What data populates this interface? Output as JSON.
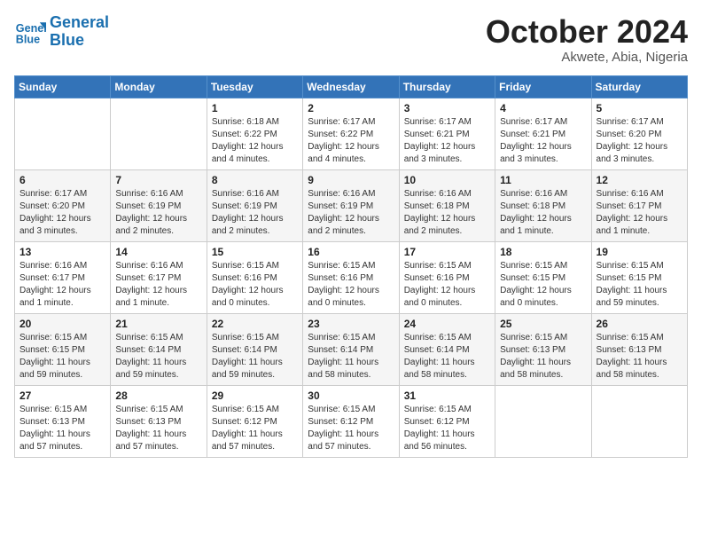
{
  "logo": {
    "line1": "General",
    "line2": "Blue"
  },
  "title": "October 2024",
  "location": "Akwete, Abia, Nigeria",
  "weekdays": [
    "Sunday",
    "Monday",
    "Tuesday",
    "Wednesday",
    "Thursday",
    "Friday",
    "Saturday"
  ],
  "weeks": [
    [
      {
        "day": "",
        "detail": ""
      },
      {
        "day": "",
        "detail": ""
      },
      {
        "day": "1",
        "detail": "Sunrise: 6:18 AM\nSunset: 6:22 PM\nDaylight: 12 hours\nand 4 minutes."
      },
      {
        "day": "2",
        "detail": "Sunrise: 6:17 AM\nSunset: 6:22 PM\nDaylight: 12 hours\nand 4 minutes."
      },
      {
        "day": "3",
        "detail": "Sunrise: 6:17 AM\nSunset: 6:21 PM\nDaylight: 12 hours\nand 3 minutes."
      },
      {
        "day": "4",
        "detail": "Sunrise: 6:17 AM\nSunset: 6:21 PM\nDaylight: 12 hours\nand 3 minutes."
      },
      {
        "day": "5",
        "detail": "Sunrise: 6:17 AM\nSunset: 6:20 PM\nDaylight: 12 hours\nand 3 minutes."
      }
    ],
    [
      {
        "day": "6",
        "detail": "Sunrise: 6:17 AM\nSunset: 6:20 PM\nDaylight: 12 hours\nand 3 minutes."
      },
      {
        "day": "7",
        "detail": "Sunrise: 6:16 AM\nSunset: 6:19 PM\nDaylight: 12 hours\nand 2 minutes."
      },
      {
        "day": "8",
        "detail": "Sunrise: 6:16 AM\nSunset: 6:19 PM\nDaylight: 12 hours\nand 2 minutes."
      },
      {
        "day": "9",
        "detail": "Sunrise: 6:16 AM\nSunset: 6:19 PM\nDaylight: 12 hours\nand 2 minutes."
      },
      {
        "day": "10",
        "detail": "Sunrise: 6:16 AM\nSunset: 6:18 PM\nDaylight: 12 hours\nand 2 minutes."
      },
      {
        "day": "11",
        "detail": "Sunrise: 6:16 AM\nSunset: 6:18 PM\nDaylight: 12 hours\nand 1 minute."
      },
      {
        "day": "12",
        "detail": "Sunrise: 6:16 AM\nSunset: 6:17 PM\nDaylight: 12 hours\nand 1 minute."
      }
    ],
    [
      {
        "day": "13",
        "detail": "Sunrise: 6:16 AM\nSunset: 6:17 PM\nDaylight: 12 hours\nand 1 minute."
      },
      {
        "day": "14",
        "detail": "Sunrise: 6:16 AM\nSunset: 6:17 PM\nDaylight: 12 hours\nand 1 minute."
      },
      {
        "day": "15",
        "detail": "Sunrise: 6:15 AM\nSunset: 6:16 PM\nDaylight: 12 hours\nand 0 minutes."
      },
      {
        "day": "16",
        "detail": "Sunrise: 6:15 AM\nSunset: 6:16 PM\nDaylight: 12 hours\nand 0 minutes."
      },
      {
        "day": "17",
        "detail": "Sunrise: 6:15 AM\nSunset: 6:16 PM\nDaylight: 12 hours\nand 0 minutes."
      },
      {
        "day": "18",
        "detail": "Sunrise: 6:15 AM\nSunset: 6:15 PM\nDaylight: 12 hours\nand 0 minutes."
      },
      {
        "day": "19",
        "detail": "Sunrise: 6:15 AM\nSunset: 6:15 PM\nDaylight: 11 hours\nand 59 minutes."
      }
    ],
    [
      {
        "day": "20",
        "detail": "Sunrise: 6:15 AM\nSunset: 6:15 PM\nDaylight: 11 hours\nand 59 minutes."
      },
      {
        "day": "21",
        "detail": "Sunrise: 6:15 AM\nSunset: 6:14 PM\nDaylight: 11 hours\nand 59 minutes."
      },
      {
        "day": "22",
        "detail": "Sunrise: 6:15 AM\nSunset: 6:14 PM\nDaylight: 11 hours\nand 59 minutes."
      },
      {
        "day": "23",
        "detail": "Sunrise: 6:15 AM\nSunset: 6:14 PM\nDaylight: 11 hours\nand 58 minutes."
      },
      {
        "day": "24",
        "detail": "Sunrise: 6:15 AM\nSunset: 6:14 PM\nDaylight: 11 hours\nand 58 minutes."
      },
      {
        "day": "25",
        "detail": "Sunrise: 6:15 AM\nSunset: 6:13 PM\nDaylight: 11 hours\nand 58 minutes."
      },
      {
        "day": "26",
        "detail": "Sunrise: 6:15 AM\nSunset: 6:13 PM\nDaylight: 11 hours\nand 58 minutes."
      }
    ],
    [
      {
        "day": "27",
        "detail": "Sunrise: 6:15 AM\nSunset: 6:13 PM\nDaylight: 11 hours\nand 57 minutes."
      },
      {
        "day": "28",
        "detail": "Sunrise: 6:15 AM\nSunset: 6:13 PM\nDaylight: 11 hours\nand 57 minutes."
      },
      {
        "day": "29",
        "detail": "Sunrise: 6:15 AM\nSunset: 6:12 PM\nDaylight: 11 hours\nand 57 minutes."
      },
      {
        "day": "30",
        "detail": "Sunrise: 6:15 AM\nSunset: 6:12 PM\nDaylight: 11 hours\nand 57 minutes."
      },
      {
        "day": "31",
        "detail": "Sunrise: 6:15 AM\nSunset: 6:12 PM\nDaylight: 11 hours\nand 56 minutes."
      },
      {
        "day": "",
        "detail": ""
      },
      {
        "day": "",
        "detail": ""
      }
    ]
  ]
}
